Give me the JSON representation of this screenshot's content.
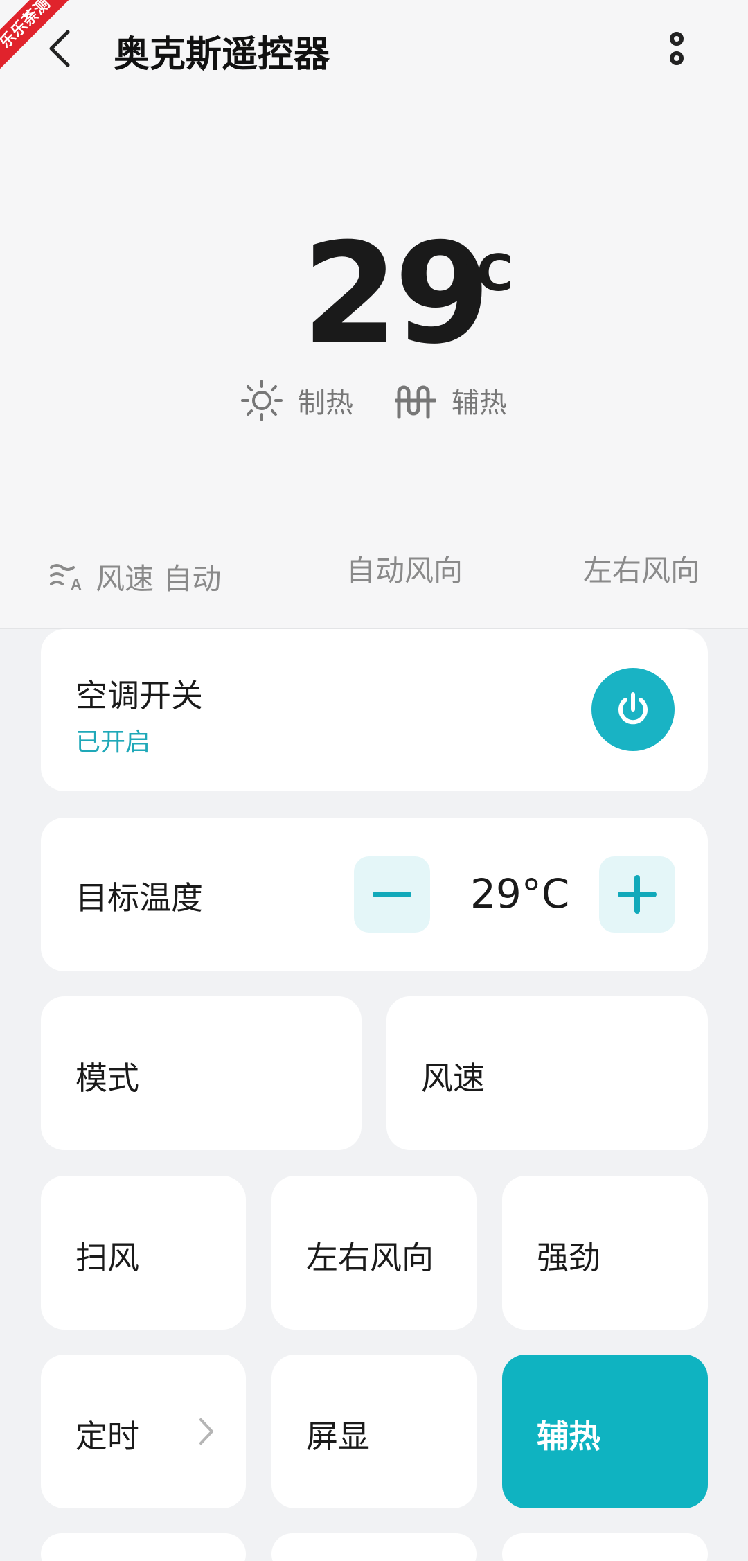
{
  "header": {
    "title": "奥克斯遥控器",
    "ribbon_text": "乐乐荼测"
  },
  "display": {
    "temperature": "29",
    "unit": "°C",
    "mode_label": "制热",
    "aux_label": "辅热"
  },
  "settings_row": {
    "fan_speed": "风速 自动",
    "auto_direction": "自动风向",
    "lr_direction": "左右风向"
  },
  "power_card": {
    "label": "空调开关",
    "status": "已开启"
  },
  "temp_card": {
    "label": "目标温度",
    "value": "29°C"
  },
  "grid": {
    "mode": "模式",
    "fan_speed": "风速",
    "swing": "扫风",
    "lr_direction": "左右风向",
    "turbo": "强劲",
    "timer": "定时",
    "display": "屏显",
    "aux_heat": "辅热"
  },
  "colors": {
    "accent": "#19b3c4",
    "active_tile": "#0fb3c1",
    "status_text": "#1fa8b8"
  }
}
